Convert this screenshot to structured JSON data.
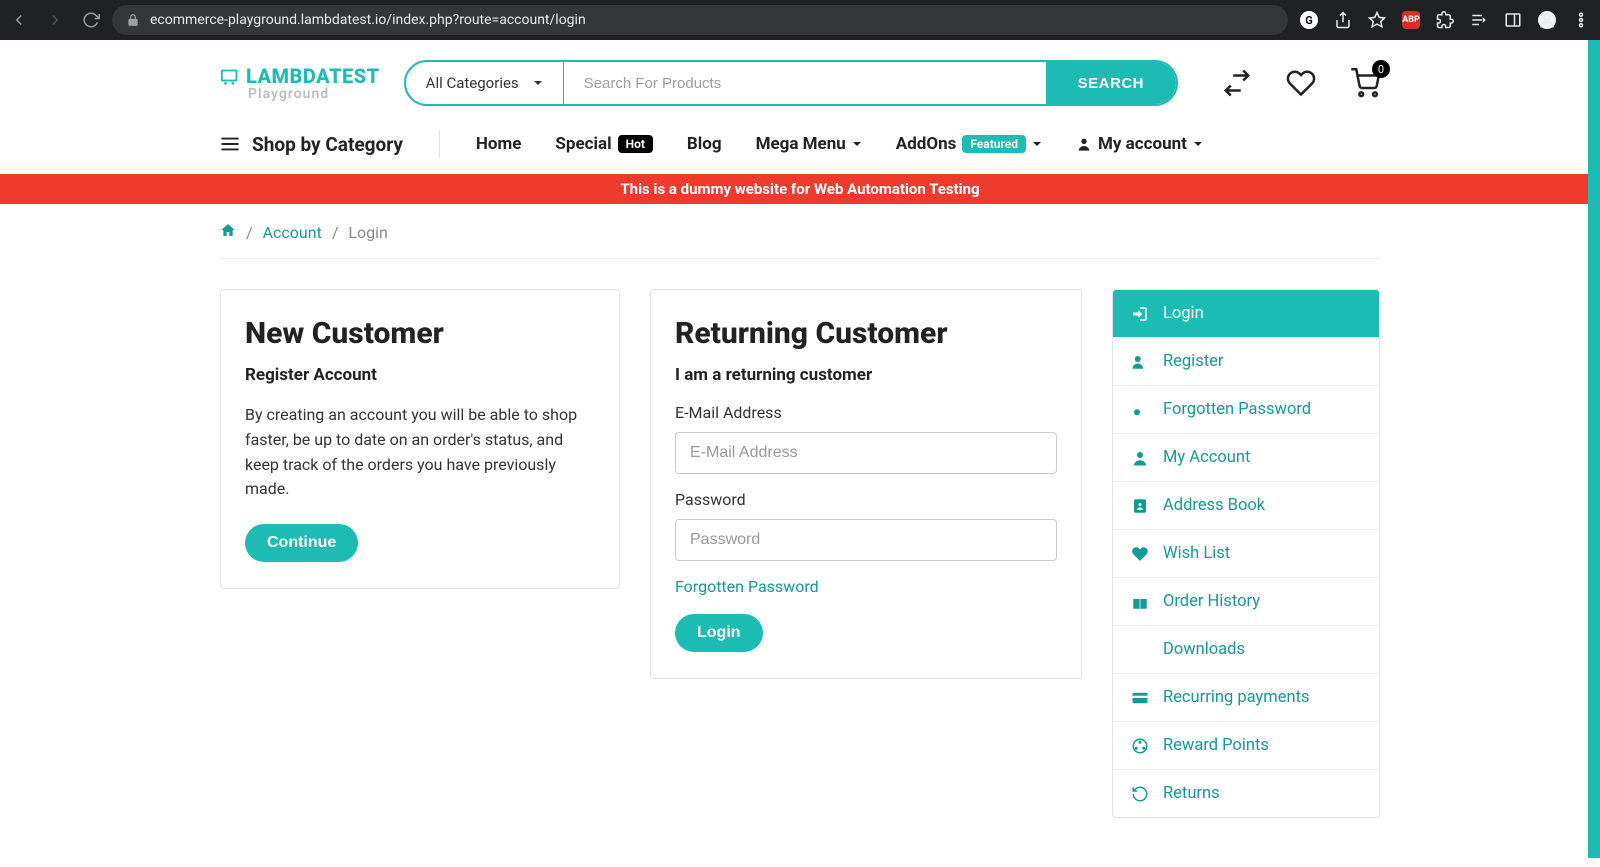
{
  "browser": {
    "url": "ecommerce-playground.lambdatest.io/index.php?route=account/login"
  },
  "logo": {
    "brand": "LAMBDATEST",
    "sub": "Playground"
  },
  "search": {
    "category": "All Categories",
    "placeholder": "Search For Products",
    "button": "SEARCH"
  },
  "cart": {
    "count": "0"
  },
  "nav": {
    "shop_by": "Shop by Category",
    "home": "Home",
    "special": "Special",
    "special_badge": "Hot",
    "blog": "Blog",
    "mega": "Mega Menu",
    "addons": "AddOns",
    "addons_badge": "Featured",
    "account": "My account"
  },
  "banner": "This is a dummy website for Web Automation Testing",
  "breadcrumb": {
    "account": "Account",
    "login": "Login"
  },
  "new_customer": {
    "title": "New Customer",
    "subtitle": "Register Account",
    "body": "By creating an account you will be able to shop faster, be up to date on an order's status, and keep track of the orders you have previously made.",
    "button": "Continue"
  },
  "returning": {
    "title": "Returning Customer",
    "subtitle": "I am a returning customer",
    "email_label": "E-Mail Address",
    "email_placeholder": "E-Mail Address",
    "password_label": "Password",
    "password_placeholder": "Password",
    "forgot": "Forgotten Password",
    "button": "Login"
  },
  "sidemenu": {
    "login": "Login",
    "register": "Register",
    "forgotten": "Forgotten Password",
    "my_account": "My Account",
    "address_book": "Address Book",
    "wish_list": "Wish List",
    "order_history": "Order History",
    "downloads": "Downloads",
    "recurring": "Recurring payments",
    "reward": "Reward Points",
    "returns": "Returns"
  }
}
